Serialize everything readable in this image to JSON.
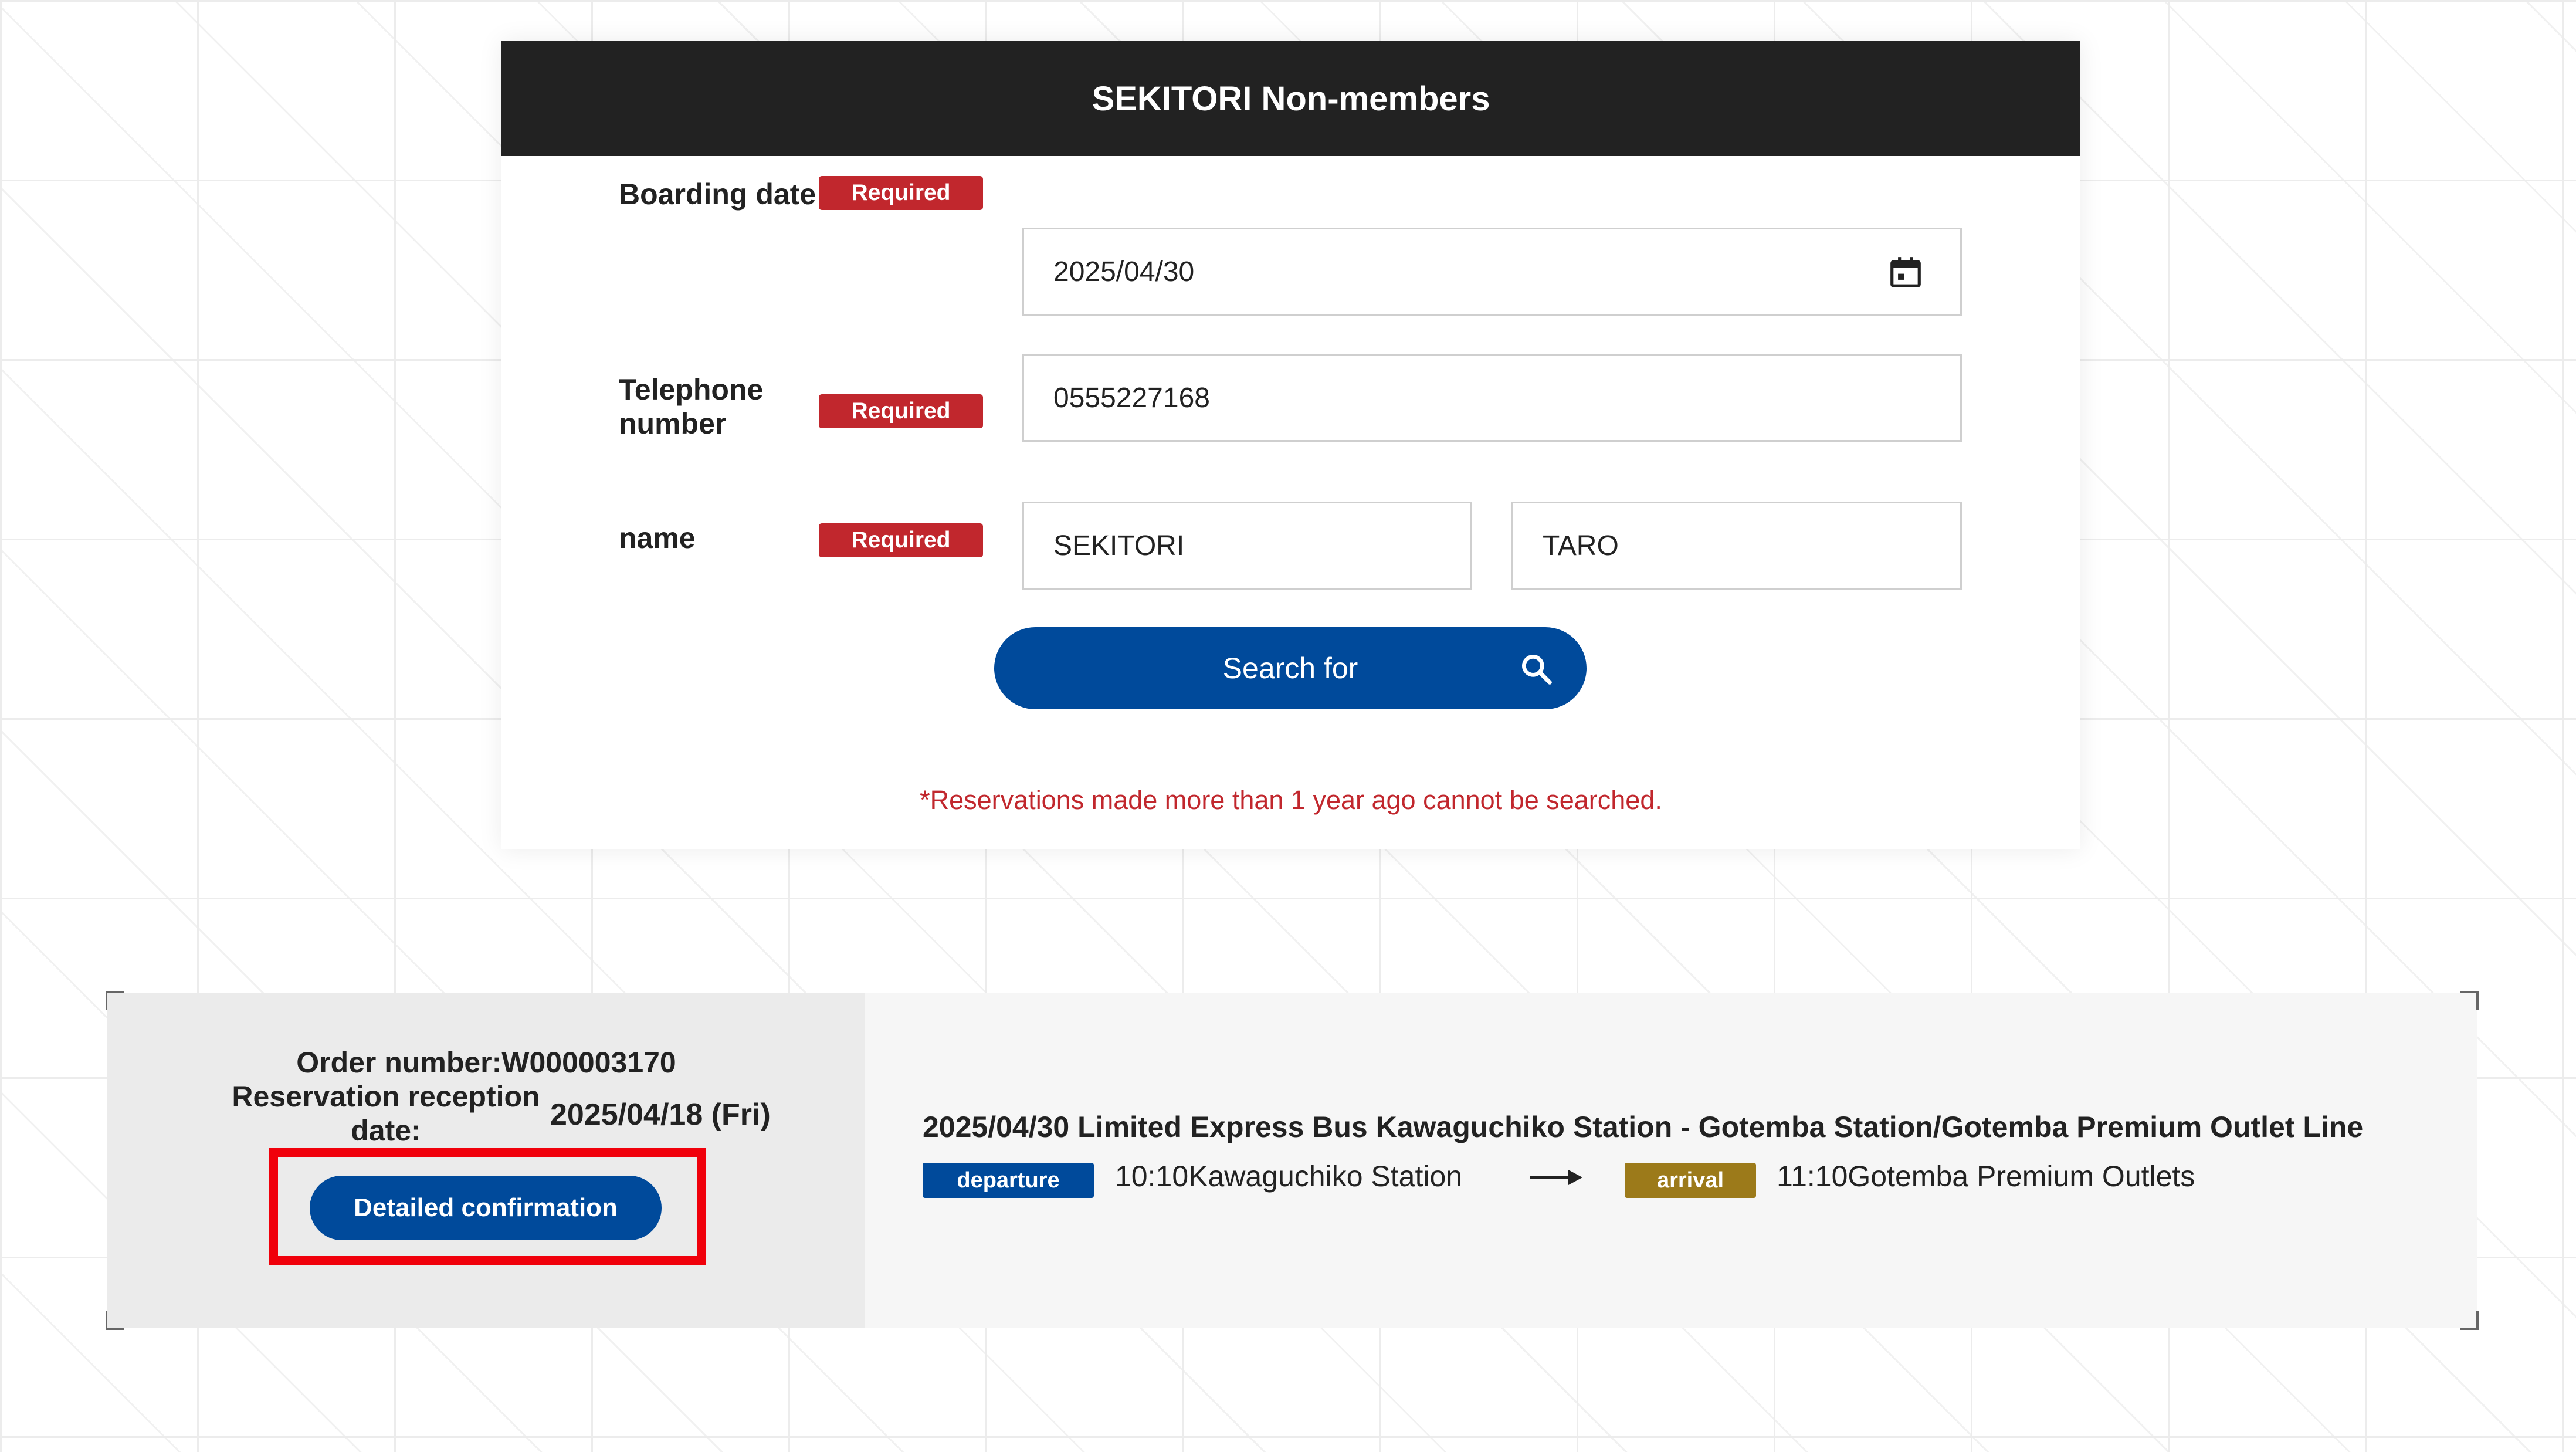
{
  "search": {
    "title": "SEKITORI Non-members",
    "required_label": "Required",
    "boarding_date": {
      "label": "Boarding date",
      "value": "2025/04/30"
    },
    "telephone": {
      "label_line1": "Telephone",
      "label_line2": "number",
      "value": "0555227168"
    },
    "name": {
      "label": "name",
      "last": "SEKITORI",
      "first": "TARO"
    },
    "search_button": "Search for",
    "note": "*Reservations made more than 1 year ago cannot be searched."
  },
  "result": {
    "order_number": "Order number:W000003170",
    "reception_label_line1": "Reservation reception",
    "reception_label_line2": "date:",
    "reception_date": "2025/04/18 (Fri)",
    "detail_button": "Detailed confirmation",
    "route_title": "2025/04/30 Limited Express Bus Kawaguchiko Station - Gotemba Station/Gotemba Premium Outlet Line",
    "departure_tag": "departure",
    "departure": "10:10Kawaguchiko Station",
    "arrival_tag": "arrival",
    "arrival": "11:10Gotemba Premium Outlets"
  },
  "colors": {
    "header": "#222222",
    "required": "#c1272d",
    "primary": "#004a9b",
    "arrival": "#9c7a1a",
    "highlight": "#f0000b"
  }
}
